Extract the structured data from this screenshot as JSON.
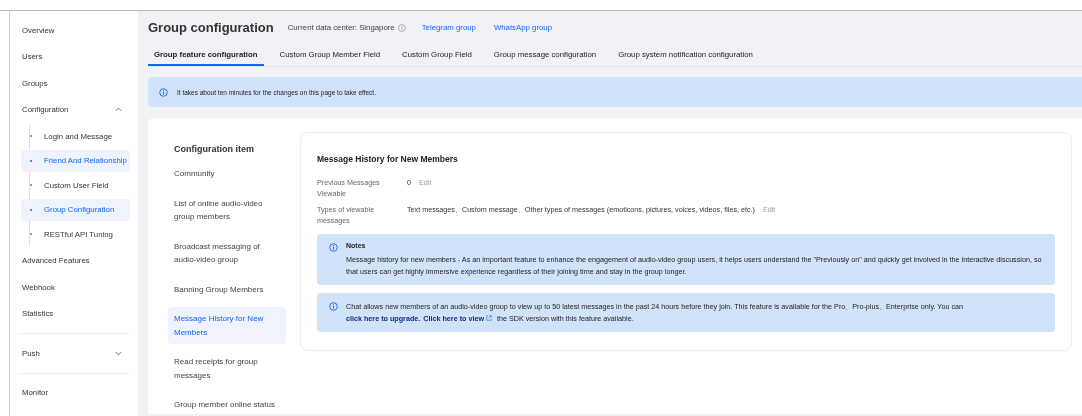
{
  "sidebar": {
    "items": [
      {
        "label": "Overview",
        "selected": false
      },
      {
        "label": "Users",
        "selected": false
      },
      {
        "label": "Groups",
        "selected": false
      },
      {
        "label": "Configuration",
        "selected": false,
        "expanded": true,
        "children": [
          {
            "label": "Login and Message",
            "selected": false
          },
          {
            "label": "Friend And Relationship",
            "selected": true
          },
          {
            "label": "Custom User Field",
            "selected": false
          },
          {
            "label": "Group Configuration",
            "selected": true
          },
          {
            "label": "RESTful API Tuning",
            "selected": false
          }
        ]
      },
      {
        "label": "Advanced Features",
        "selected": false
      },
      {
        "label": "Webhook",
        "selected": false
      },
      {
        "label": "Statistics",
        "selected": false,
        "divider_after": true
      },
      {
        "label": "Push",
        "selected": false,
        "expanded": false,
        "divider_after": true
      },
      {
        "label": "Monitor",
        "selected": false
      }
    ]
  },
  "header": {
    "title": "Group configuration",
    "data_center": "Current data center: Singapore",
    "links": [
      "Telegram group",
      "WhatsApp group"
    ]
  },
  "tabs": [
    {
      "label": "Group feature configuration",
      "selected": true
    },
    {
      "label": "Custom Group Member Field",
      "selected": false
    },
    {
      "label": "Custom Group Field",
      "selected": false
    },
    {
      "label": "Group message configuration",
      "selected": false
    },
    {
      "label": "Group system notification configuration",
      "selected": false
    }
  ],
  "banner": "It takes about ten minutes for the changes on this page to take effect.",
  "config": {
    "heading": "Configuration item",
    "items": [
      {
        "label": "Community",
        "selected": false
      },
      {
        "label": "List of online audio-video group members",
        "selected": false
      },
      {
        "label": "Broadcast messaging of audio-video group",
        "selected": false
      },
      {
        "label": "Banning Group Members",
        "selected": false
      },
      {
        "label": "Message History for New Members",
        "selected": true
      },
      {
        "label": "Read receipts for group messages",
        "selected": false
      },
      {
        "label": "Group member online status",
        "selected": false
      }
    ]
  },
  "detail": {
    "title": "Message History for New Members",
    "fields": [
      {
        "label": "Previous Messages Viewable",
        "value": "0",
        "action": "Edit"
      },
      {
        "label": "Types of viewable messages",
        "value": "Text messages、Custom message、Other types of messages (emoticons, pictures, voices, videos, files, etc.)",
        "action": "Edit"
      }
    ],
    "notes": {
      "title": "Notes",
      "text": "Message history for new members - As an important feature to enhance the engagement of audio-video group users, it helps users understand the \"Previously on\" and quickly get involved in the interactive discussion, so that users can get highly immersive experience regardless of their joining time and stay in the group longer."
    },
    "info": [
      {
        "kind": "text",
        "text": "Chat allows new members of an audio-video group to view up to 50 latest messages in the past 24 hours before they join. This feature is available for the Pro、Pro-plus、Enterprise only. You can "
      },
      {
        "kind": "link",
        "text": "click here to upgrade."
      },
      {
        "kind": "extlink",
        "text": "Click here to view"
      },
      {
        "kind": "text",
        "text": " the SDK version with this feature available."
      }
    ]
  }
}
